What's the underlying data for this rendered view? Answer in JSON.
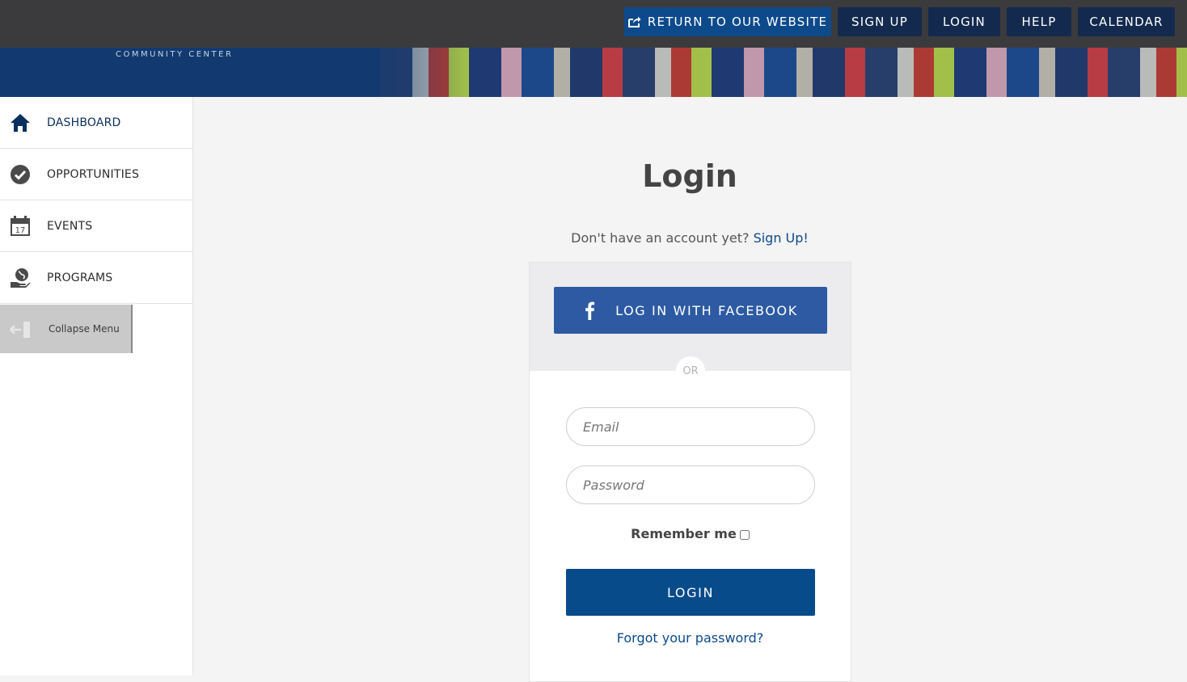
{
  "topnav": {
    "return_label": "Return to our website",
    "signup_label": "Sign Up",
    "login_label": "Login",
    "help_label": "Help",
    "calendar_label": "Calendar"
  },
  "banner": {
    "subtitle": "COMMUNITY CENTER"
  },
  "sidebar": {
    "items": [
      {
        "label": "DASHBOARD",
        "icon": "home-icon"
      },
      {
        "label": "OPPORTUNITIES",
        "icon": "check-circle-icon"
      },
      {
        "label": "EVENTS",
        "icon": "calendar-icon",
        "icon_day": "17"
      },
      {
        "label": "PROGRAMS",
        "icon": "globe-hand-icon"
      }
    ],
    "collapse_label": "Collapse Menu"
  },
  "main": {
    "title": "Login",
    "no_account_text": "Don't have an account yet?",
    "signup_link": "Sign Up!",
    "facebook_label": "LOG IN WITH FACEBOOK",
    "or_label": "OR",
    "email_placeholder": "Email",
    "password_placeholder": "Password",
    "remember_label": "Remember me",
    "login_button": "LOGIN",
    "forgot_link": "Forgot your password?"
  },
  "colors": {
    "topbar_bg": "#3b3b3d",
    "nav_button_bg": "#132a4e",
    "return_button_bg": "#0d4a8b",
    "facebook_bg": "#2d5aa3",
    "login_button_bg": "#084b8a",
    "link": "#0b4a8a"
  }
}
